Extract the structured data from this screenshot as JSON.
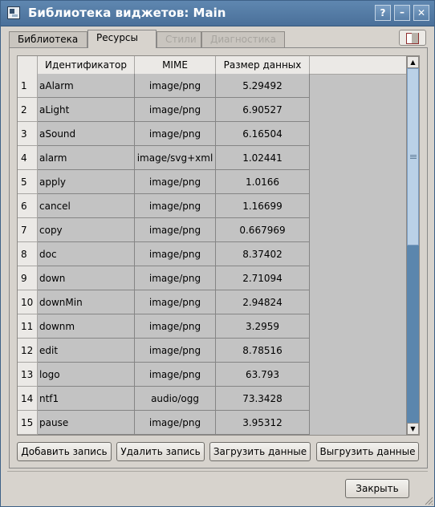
{
  "window": {
    "title": "Библиотека виджетов: Main",
    "buttons": {
      "help": "?",
      "minimize": "–",
      "close": "✕"
    }
  },
  "tabs": [
    {
      "label": "Библиотека",
      "state": "normal"
    },
    {
      "label": "Ресурсы",
      "state": "active"
    },
    {
      "label": "Стили",
      "state": "disabled"
    },
    {
      "label": "Диагностика",
      "state": "disabled"
    }
  ],
  "table": {
    "columns": [
      "Идентификатор",
      "MIME",
      "Размер данных"
    ],
    "rows": [
      {
        "n": "1",
        "id": "aAlarm",
        "mime": "image/png",
        "size": "5.29492"
      },
      {
        "n": "2",
        "id": "aLight",
        "mime": "image/png",
        "size": "6.90527"
      },
      {
        "n": "3",
        "id": "aSound",
        "mime": "image/png",
        "size": "6.16504"
      },
      {
        "n": "4",
        "id": "alarm",
        "mime": "image/svg+xml",
        "size": "1.02441"
      },
      {
        "n": "5",
        "id": "apply",
        "mime": "image/png",
        "size": "1.0166"
      },
      {
        "n": "6",
        "id": "cancel",
        "mime": "image/png",
        "size": "1.16699"
      },
      {
        "n": "7",
        "id": "copy",
        "mime": "image/png",
        "size": "0.667969"
      },
      {
        "n": "8",
        "id": "doc",
        "mime": "image/png",
        "size": "8.37402"
      },
      {
        "n": "9",
        "id": "down",
        "mime": "image/png",
        "size": "2.71094"
      },
      {
        "n": "10",
        "id": "downMin",
        "mime": "image/png",
        "size": "2.94824"
      },
      {
        "n": "11",
        "id": "downm",
        "mime": "image/png",
        "size": "3.2959"
      },
      {
        "n": "12",
        "id": "edit",
        "mime": "image/png",
        "size": "8.78516"
      },
      {
        "n": "13",
        "id": "logo",
        "mime": "image/png",
        "size": "63.793"
      },
      {
        "n": "14",
        "id": "ntf1",
        "mime": "audio/ogg",
        "size": "73.3428"
      },
      {
        "n": "15",
        "id": "pause",
        "mime": "image/png",
        "size": "3.95312"
      }
    ]
  },
  "actions": {
    "add": "Добавить запись",
    "delete": "Удалить запись",
    "load": "Загрузить данные",
    "unload": "Выгрузить данные"
  },
  "close_button": "Закрыть",
  "scrollbar": {
    "position_fraction": 0.0,
    "visible_fraction": 0.5
  },
  "colors": {
    "title_bar": "#4f769f",
    "scroll_track": "#5b86ad",
    "table_bg": "#c3c3c3"
  }
}
